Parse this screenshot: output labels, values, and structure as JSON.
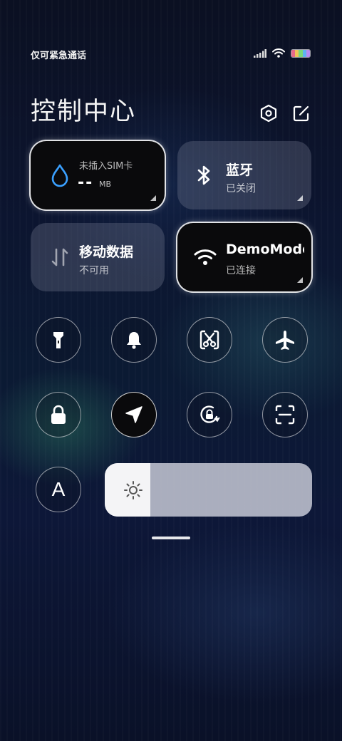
{
  "status_bar": {
    "carrier_text": "仅可紧急通话",
    "signal_icon": "signal-icon",
    "wifi_icon": "wifi-icon",
    "battery_icon": "battery-icon"
  },
  "header": {
    "title": "控制中心",
    "settings_icon": "settings-hexagon-icon",
    "edit_icon": "edit-icon"
  },
  "tiles": {
    "sim": {
      "label": "未插入SIM卡",
      "value": "--",
      "unit": "MB",
      "icon": "water-drop-icon",
      "state": "active"
    },
    "bluetooth": {
      "title": "蓝牙",
      "subtitle": "已关闭",
      "icon": "bluetooth-icon",
      "state": "inactive"
    },
    "mobile_data": {
      "title": "移动数据",
      "subtitle": "不可用",
      "icon": "data-arrows-icon",
      "state": "inactive"
    },
    "wifi": {
      "title": "DemoMode",
      "subtitle": "已连接",
      "icon": "wifi-icon",
      "state": "active"
    }
  },
  "toggles_row1": [
    "flashlight-icon",
    "bell-icon",
    "screenshot-scissors-icon",
    "airplane-icon"
  ],
  "toggles_row2": [
    "lock-icon",
    "location-arrow-icon",
    "rotation-lock-icon",
    "scan-icon"
  ],
  "auto_brightness_label": "A",
  "brightness": {
    "level": 0.22,
    "icon": "sun-icon"
  },
  "colors": {
    "accent_blue": "#3aa0ff",
    "active_tile": "#0a0a0c",
    "battery_stripes": [
      "#e86a8a",
      "#f1c35a",
      "#7ad87a",
      "#5fb3f0",
      "#b88af0"
    ]
  }
}
